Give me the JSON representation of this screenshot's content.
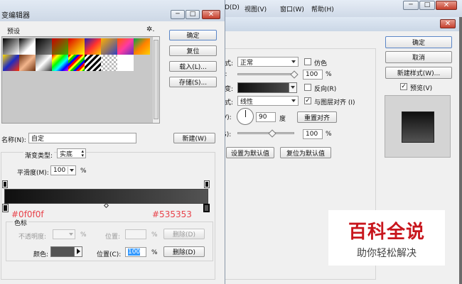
{
  "app": {
    "menu": [
      "D(D)",
      "视图(V)",
      "窗口(W)",
      "帮助(H)"
    ],
    "window_controls": {
      "minimize": "─",
      "maximize": "□",
      "close": "✕"
    }
  },
  "layer_style": {
    "blend_label": "式:",
    "blend_value": "正常",
    "dither_label": "仿色",
    "opacity_prefix": "):",
    "opacity_value": "100",
    "opacity_unit": "%",
    "gradient_label": "变:",
    "reverse_label": "反向(R)",
    "style_label": "式:",
    "style_value": "线性",
    "align_label": "与图层对齐 (I)",
    "angle_label": "V):",
    "angle_value": "90",
    "angle_unit": "度",
    "reset_align": "重置对齐",
    "scale_label": "S):",
    "scale_value": "100",
    "scale_unit": "%",
    "set_default": "设置为默认值",
    "reset_default": "复位为默认值",
    "ok": "确定",
    "cancel": "取消",
    "new_style": "新建样式(W)...",
    "preview_label": "预览(V)",
    "close": "✕"
  },
  "gradient_editor": {
    "title": "变编辑器",
    "window_controls": {
      "minimize": "─",
      "maximize": "□",
      "close": "✕"
    },
    "presets_label": "预设",
    "settings_icon_text": "✲.",
    "buttons": {
      "ok": "确定",
      "reset": "复位",
      "load": "载入(L)...",
      "save": "存储(S)..."
    },
    "name_label": "名称(N):",
    "name_value": "自定",
    "new_button": "新建(W)",
    "type_label": "渐变类型:",
    "type_value": "实底",
    "smoothness_label": "平滑度(M):",
    "smoothness_value": "100",
    "smoothness_unit": "%",
    "start_color_annotation": "#0f0f0f",
    "end_color_annotation": "#535353",
    "stops_group_label": "色标",
    "opacity_label": "不透明度:",
    "opacity_unit": "%",
    "location_label_top": "位置:",
    "location_unit_top": "%",
    "delete_top": "删除(D)",
    "color_label": "颜色:",
    "location_label": "位置(C):",
    "location_value": "100",
    "location_unit": "%",
    "delete_button": "删除(D)"
  },
  "watermark": {
    "title": "百科全说",
    "subtitle": "助你轻松解决"
  },
  "colors": {
    "gradient_start": "#0f0f0f",
    "gradient_end": "#535353",
    "annotation": "#e8424a",
    "watermark_red": "#c8161d",
    "title_bar": "#dbe4f0",
    "dialog_bg": "#f0f0f0"
  }
}
